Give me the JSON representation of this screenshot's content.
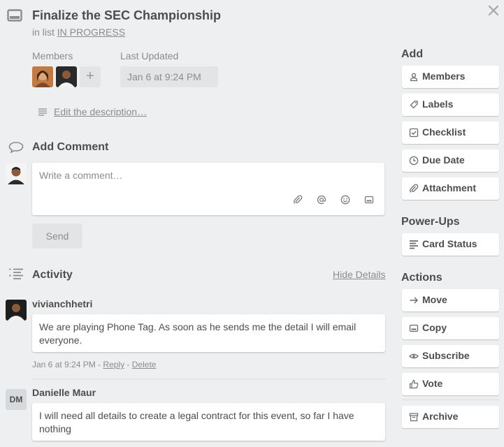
{
  "card": {
    "title": "Finalize the SEC Championship",
    "in_list_prefix": "in list",
    "list_name": "IN PROGRESS"
  },
  "members": {
    "label": "Members",
    "add_symbol": "+"
  },
  "last_updated": {
    "label": "Last Updated",
    "value": "Jan 6 at 9:24 PM"
  },
  "description": {
    "link": "Edit the description…"
  },
  "comment": {
    "title": "Add Comment",
    "placeholder": "Write a comment…",
    "send_label": "Send"
  },
  "activity": {
    "title": "Activity",
    "hide_details": "Hide Details",
    "items": [
      {
        "author": "vivianchhetri",
        "text": "We are playing Phone Tag. As soon as he sends me the detail I will email everyone.",
        "time": "Jan 6 at 9:24 PM",
        "sep1": " - ",
        "reply": "Reply",
        "sep2": " - ",
        "delete": "Delete"
      },
      {
        "author": "Danielle Maur",
        "initials": "DM",
        "text": "I will need all details to create a legal contract for this event, so far I have nothing"
      }
    ]
  },
  "sidebar": {
    "add_title": "Add",
    "add_buttons": [
      "Members",
      "Labels",
      "Checklist",
      "Due Date",
      "Attachment"
    ],
    "powerups_title": "Power-Ups",
    "powerups_buttons": [
      "Card Status"
    ],
    "actions_title": "Actions",
    "action_buttons": [
      "Move",
      "Copy",
      "Subscribe",
      "Vote",
      "Archive"
    ]
  },
  "colors": {
    "background": "#edeff0",
    "text": "#4d4d4d",
    "muted": "#8c8c8c",
    "button_bg": "#e2e4e6"
  }
}
